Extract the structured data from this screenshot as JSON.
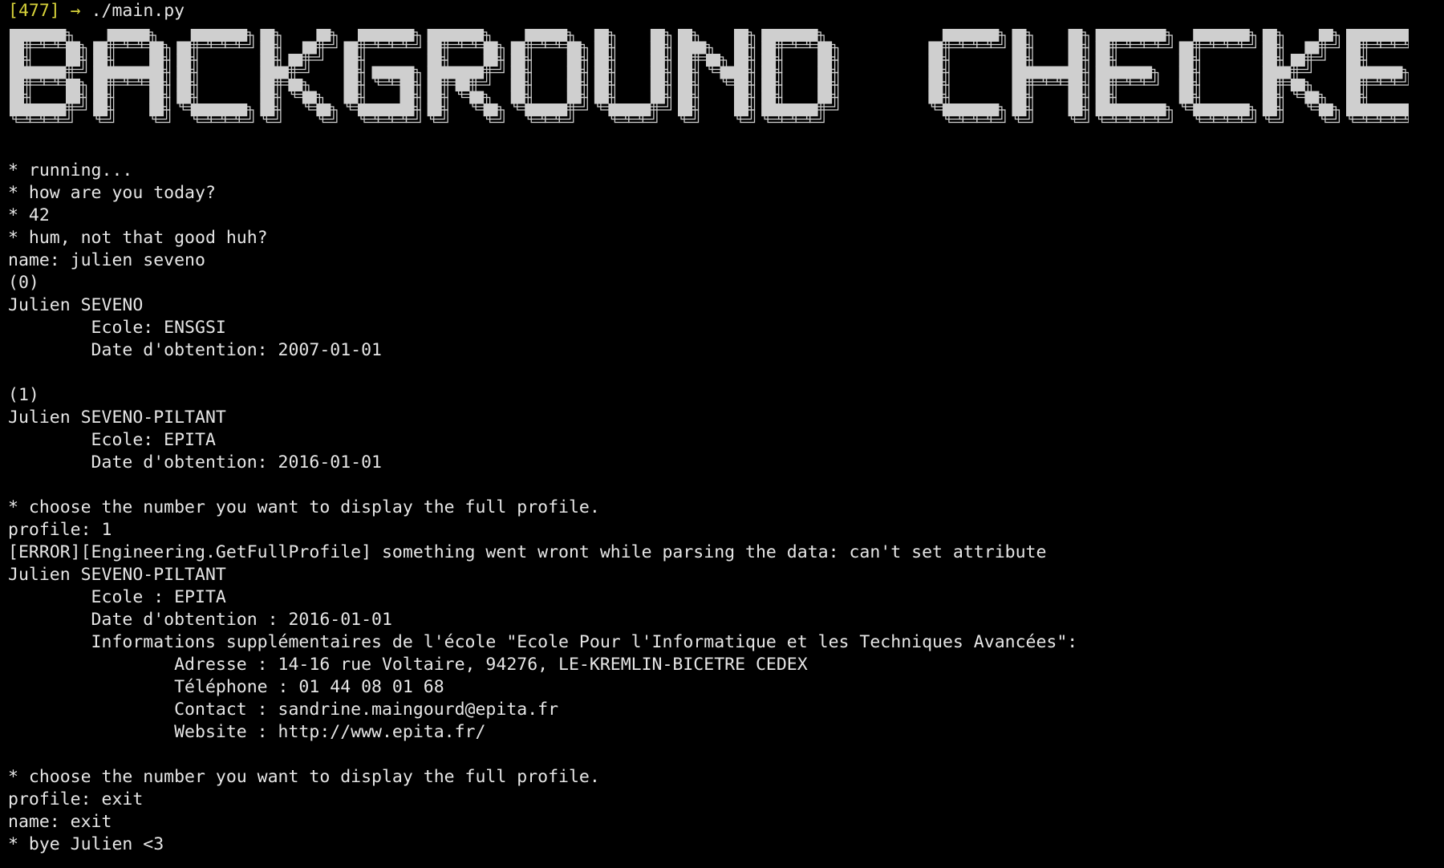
{
  "prompt": {
    "number": "[477]",
    "arrow": "→",
    "command": "./main.py"
  },
  "banner": {
    "text": "BACKGROUND CHECKER",
    "color": "#cfcfcf"
  },
  "output": [
    "* running...",
    "* how are you today?",
    "* 42",
    "* hum, not that good huh?",
    "name: julien seveno",
    "(0)",
    "Julien SEVENO",
    "        Ecole: ENSGSI",
    "        Date d'obtention: 2007-01-01",
    "",
    "(1)",
    "Julien SEVENO-PILTANT",
    "        Ecole: EPITA",
    "        Date d'obtention: 2016-01-01",
    "",
    "* choose the number you want to display the full profile.",
    "profile: 1",
    "[ERROR][Engineering.GetFullProfile] something went wront while parsing the data: can't set attribute",
    "Julien SEVENO-PILTANT",
    "        Ecole : EPITA",
    "        Date d'obtention : 2016-01-01",
    "        Informations supplémentaires de l'école \"Ecole Pour l'Informatique et les Techniques Avancées\":",
    "                Adresse : 14-16 rue Voltaire, 94276, LE-KREMLIN-BICETRE CEDEX",
    "                Téléphone : 01 44 08 01 68",
    "                Contact : sandrine.maingourd@epita.fr",
    "                Website : http://www.epita.fr/",
    "",
    "* choose the number you want to display the full profile.",
    "profile: exit",
    "name: exit",
    "* bye Julien <3"
  ],
  "colors": {
    "background": "#000000",
    "text": "#e6e6e6",
    "prompt": "#d7d23a"
  }
}
